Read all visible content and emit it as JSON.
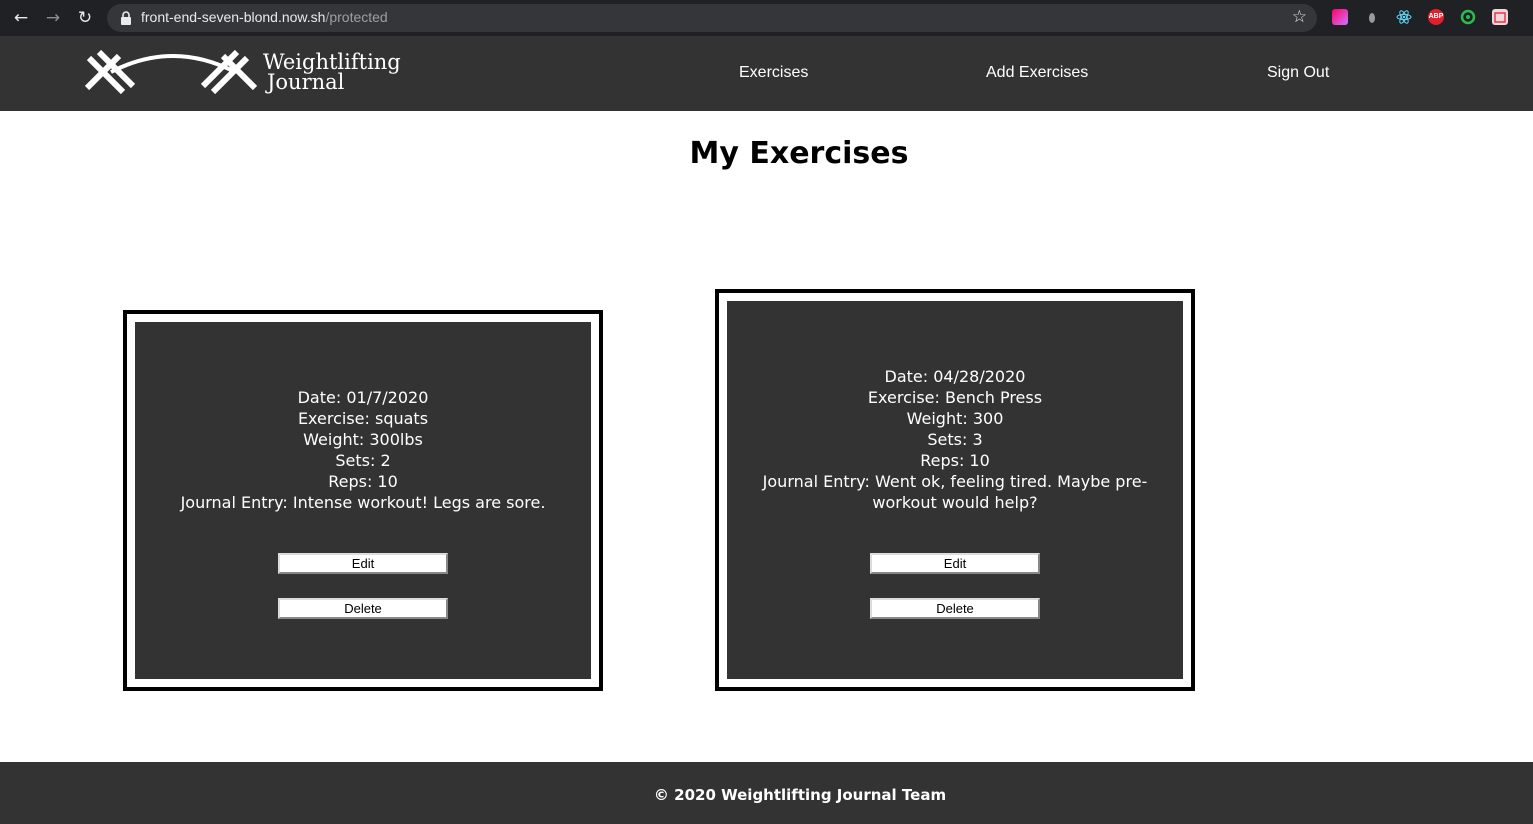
{
  "browser": {
    "url_host": "front-end-seven-blond.now.sh",
    "url_path": "/protected",
    "extensions": [
      {
        "name": "gradient-extension-icon",
        "color": "#e04ca8"
      },
      {
        "name": "mouse-extension-icon",
        "color": "#888888"
      },
      {
        "name": "react-devtools-icon",
        "color": "#61dafb"
      },
      {
        "name": "adblock-plus-icon",
        "color": "#e0202e",
        "label": "ABP"
      },
      {
        "name": "green-ring-extension-icon",
        "color": "#2dbb4f"
      },
      {
        "name": "red-extension-icon",
        "color": "#e03a4a"
      }
    ]
  },
  "header": {
    "logo_line1": "Weightlifting",
    "logo_line2": "Journal",
    "nav": {
      "exercises": "Exercises",
      "add_exercises": "Add Exercises",
      "sign_out": "Sign Out"
    }
  },
  "main": {
    "title": "My Exercises",
    "cards": [
      {
        "date": "Date: 01/7/2020",
        "exercise": "Exercise: squats",
        "weight": "Weight: 300lbs",
        "sets": "Sets: 2",
        "reps": "Reps: 10",
        "journal": "Journal Entry: Intense workout! Legs are sore.",
        "edit_label": "Edit",
        "delete_label": "Delete"
      },
      {
        "date": "Date: 04/28/2020",
        "exercise": "Exercise: Bench Press",
        "weight": "Weight: 300",
        "sets": "Sets: 3",
        "reps": "Reps: 10",
        "journal": "Journal Entry: Went ok, feeling tired. Maybe pre-workout would help?",
        "edit_label": "Edit",
        "delete_label": "Delete"
      }
    ]
  },
  "footer": {
    "text": "© 2020 Weightlifting Journal Team"
  },
  "colors": {
    "header_bg": "#333333",
    "card_bg": "#333333",
    "footer_bg": "#333333",
    "chrome_bg": "#202124"
  }
}
